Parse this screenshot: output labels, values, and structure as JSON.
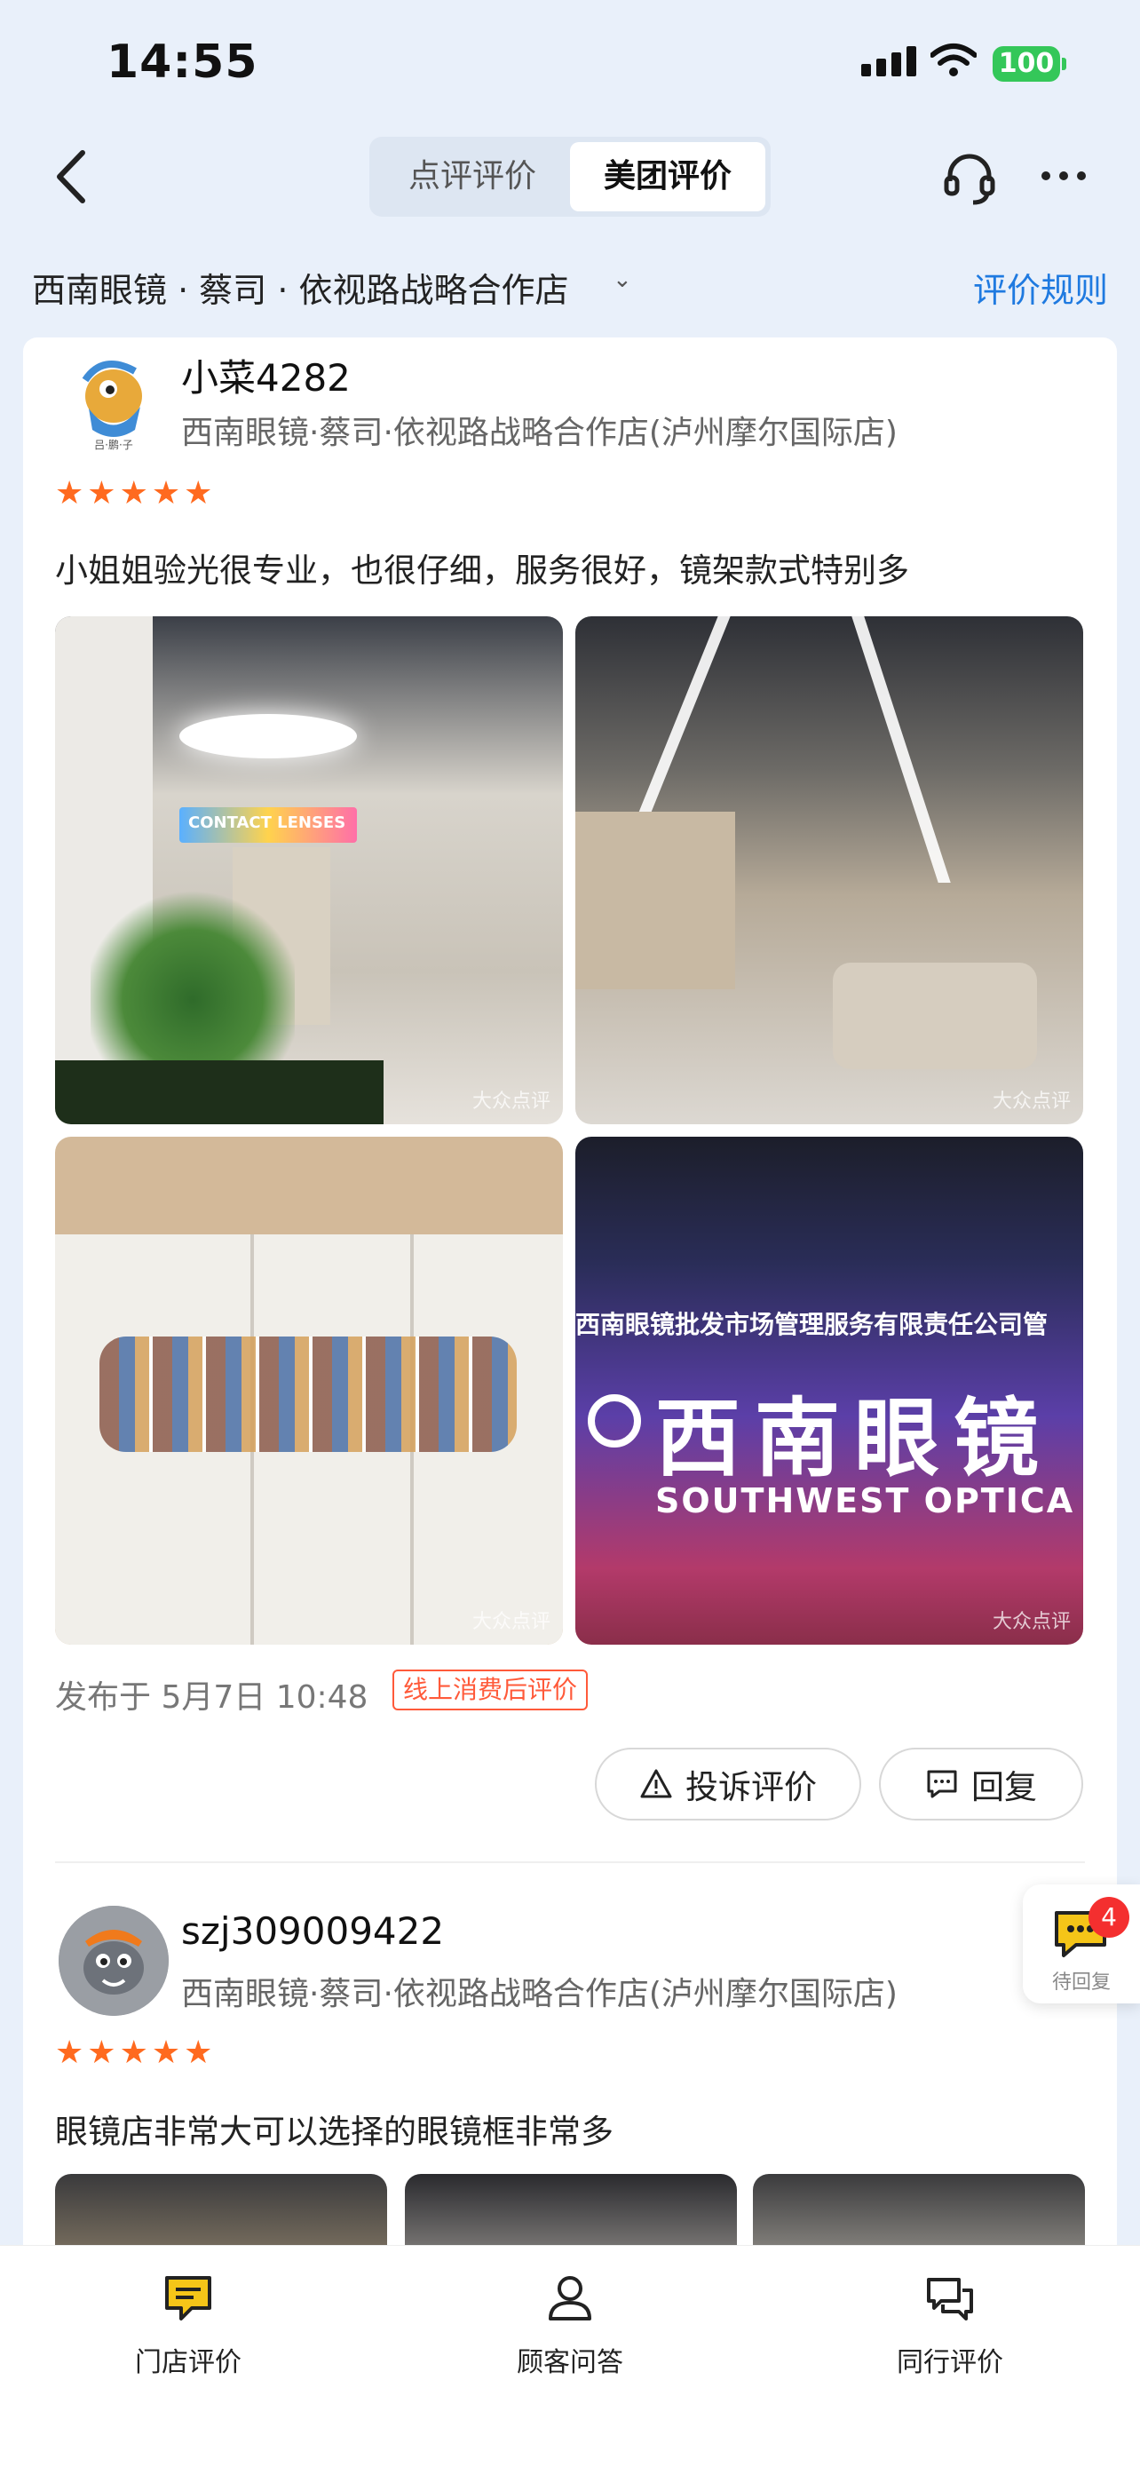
{
  "status_bar": {
    "time": "14:55",
    "battery": "100"
  },
  "nav": {
    "segments": [
      {
        "label": "点评评价",
        "active": false
      },
      {
        "label": "美团评价",
        "active": true
      }
    ]
  },
  "shop": {
    "name": "西南眼镜 · 蔡司 · 依视路战略合作店",
    "rules_link": "评价规则"
  },
  "reviews": [
    {
      "user": "小菜4282",
      "avatar_text": "吕·鹏·子",
      "shop": "西南眼镜·蔡司·依视路战略合作店(泸州摩尔国际店)",
      "stars": 5,
      "text": "小姐姐验光很专业，也很仔细，服务很好，镜架款式特别多",
      "photos": [
        {
          "sign_text": "CONTACT LENSES",
          "watermark": "大众点评"
        },
        {
          "sign_text": "",
          "watermark": "大众点评"
        },
        {
          "sign_text": "",
          "watermark": "大众点评"
        },
        {
          "sign_text": "西南眼镜批发市场管理服务有限责任公司管",
          "brand_cn": "西南眼镜",
          "brand_en": "SOUTHWEST OPTICA",
          "watermark": "大众点评"
        }
      ],
      "published": "发布于 5月7日 10:48",
      "tag": "线上消费后评价",
      "actions": {
        "complain": "投诉评价",
        "reply": "回复"
      }
    },
    {
      "user": "szj309009422",
      "shop": "西南眼镜·蔡司·依视路战略合作店(泸州摩尔国际店)",
      "stars": 5,
      "text": "眼镜店非常大可以选择的眼镜框非常多"
    }
  ],
  "floating": {
    "label": "待回复",
    "count": "4"
  },
  "tabbar": [
    {
      "label": "门店评价",
      "icon": "review-icon",
      "active": true
    },
    {
      "label": "顾客问答",
      "icon": "person-icon",
      "active": false
    },
    {
      "label": "同行评价",
      "icon": "chat-icon",
      "active": false
    }
  ],
  "colors": {
    "accent": "#1f7ae0",
    "star": "#ff6a1f",
    "tag": "#ff5a3a",
    "tab_active": "#f5c518"
  }
}
